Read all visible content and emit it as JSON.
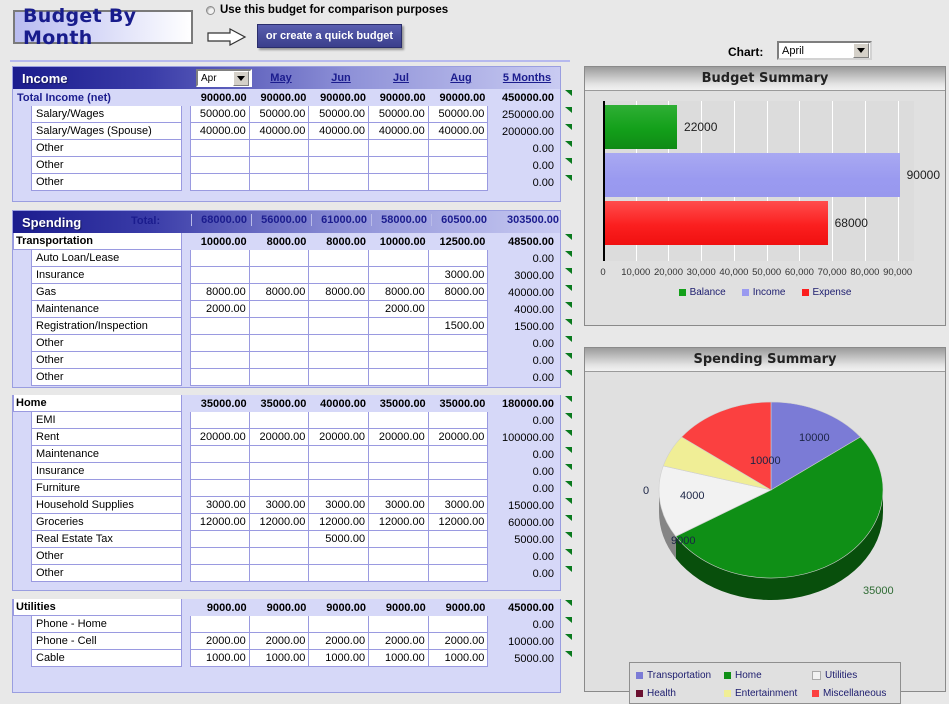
{
  "header": {
    "title": "Budget By Month",
    "comparison_label": "Use this budget for comparison purposes",
    "quick_budget_label": "or create a quick budget",
    "chart_label": "Chart:",
    "chart_selected": "April"
  },
  "columns": {
    "selected_month": "Apr",
    "months": [
      "May",
      "Jun",
      "Jul",
      "Aug"
    ],
    "total_header": "5 Months",
    "total_label": "Total:"
  },
  "income": {
    "section_title": "Income",
    "total_row": {
      "label": "Total Income (net)",
      "values": [
        "90000.00",
        "90000.00",
        "90000.00",
        "90000.00",
        "90000.00"
      ],
      "sum": "450000.00"
    },
    "rows": [
      {
        "label": "Salary/Wages",
        "values": [
          "50000.00",
          "50000.00",
          "50000.00",
          "50000.00",
          "50000.00"
        ],
        "sum": "250000.00"
      },
      {
        "label": "Salary/Wages (Spouse)",
        "values": [
          "40000.00",
          "40000.00",
          "40000.00",
          "40000.00",
          "40000.00"
        ],
        "sum": "200000.00"
      },
      {
        "label": "Other",
        "values": [
          "",
          "",
          "",
          "",
          ""
        ],
        "sum": "0.00"
      },
      {
        "label": "Other",
        "values": [
          "",
          "",
          "",
          "",
          ""
        ],
        "sum": "0.00"
      },
      {
        "label": "Other",
        "values": [
          "",
          "",
          "",
          "",
          ""
        ],
        "sum": "0.00"
      }
    ]
  },
  "spending": {
    "section_title": "Spending",
    "total_values": [
      "68000.00",
      "56000.00",
      "61000.00",
      "58000.00",
      "60500.00"
    ],
    "total_sum": "303500.00",
    "categories": [
      {
        "label": "Transportation",
        "values": [
          "10000.00",
          "8000.00",
          "8000.00",
          "10000.00",
          "12500.00"
        ],
        "sum": "48500.00",
        "rows": [
          {
            "label": "Auto Loan/Lease",
            "values": [
              "",
              "",
              "",
              "",
              ""
            ],
            "sum": "0.00"
          },
          {
            "label": "Insurance",
            "values": [
              "",
              "",
              "",
              "",
              "3000.00"
            ],
            "sum": "3000.00"
          },
          {
            "label": "Gas",
            "values": [
              "8000.00",
              "8000.00",
              "8000.00",
              "8000.00",
              "8000.00"
            ],
            "sum": "40000.00"
          },
          {
            "label": "Maintenance",
            "values": [
              "2000.00",
              "",
              "",
              "2000.00",
              ""
            ],
            "sum": "4000.00"
          },
          {
            "label": "Registration/Inspection",
            "values": [
              "",
              "",
              "",
              "",
              "1500.00"
            ],
            "sum": "1500.00"
          },
          {
            "label": "Other",
            "values": [
              "",
              "",
              "",
              "",
              ""
            ],
            "sum": "0.00"
          },
          {
            "label": "Other",
            "values": [
              "",
              "",
              "",
              "",
              ""
            ],
            "sum": "0.00"
          },
          {
            "label": "Other",
            "values": [
              "",
              "",
              "",
              "",
              ""
            ],
            "sum": "0.00"
          }
        ]
      },
      {
        "label": "Home",
        "values": [
          "35000.00",
          "35000.00",
          "40000.00",
          "35000.00",
          "35000.00"
        ],
        "sum": "180000.00",
        "rows": [
          {
            "label": "EMI",
            "values": [
              "",
              "",
              "",
              "",
              ""
            ],
            "sum": "0.00"
          },
          {
            "label": "Rent",
            "values": [
              "20000.00",
              "20000.00",
              "20000.00",
              "20000.00",
              "20000.00"
            ],
            "sum": "100000.00"
          },
          {
            "label": "Maintenance",
            "values": [
              "",
              "",
              "",
              "",
              ""
            ],
            "sum": "0.00"
          },
          {
            "label": "Insurance",
            "values": [
              "",
              "",
              "",
              "",
              ""
            ],
            "sum": "0.00"
          },
          {
            "label": "Furniture",
            "values": [
              "",
              "",
              "",
              "",
              ""
            ],
            "sum": "0.00"
          },
          {
            "label": "Household Supplies",
            "values": [
              "3000.00",
              "3000.00",
              "3000.00",
              "3000.00",
              "3000.00"
            ],
            "sum": "15000.00"
          },
          {
            "label": "Groceries",
            "values": [
              "12000.00",
              "12000.00",
              "12000.00",
              "12000.00",
              "12000.00"
            ],
            "sum": "60000.00"
          },
          {
            "label": "Real Estate Tax",
            "values": [
              "",
              "",
              "5000.00",
              "",
              ""
            ],
            "sum": "5000.00"
          },
          {
            "label": "Other",
            "values": [
              "",
              "",
              "",
              "",
              ""
            ],
            "sum": "0.00"
          },
          {
            "label": "Other",
            "values": [
              "",
              "",
              "",
              "",
              ""
            ],
            "sum": "0.00"
          }
        ]
      },
      {
        "label": "Utilities",
        "values": [
          "9000.00",
          "9000.00",
          "9000.00",
          "9000.00",
          "9000.00"
        ],
        "sum": "45000.00",
        "rows": [
          {
            "label": "Phone - Home",
            "values": [
              "",
              "",
              "",
              "",
              ""
            ],
            "sum": "0.00"
          },
          {
            "label": "Phone - Cell",
            "values": [
              "2000.00",
              "2000.00",
              "2000.00",
              "2000.00",
              "2000.00"
            ],
            "sum": "10000.00"
          },
          {
            "label": "Cable",
            "values": [
              "1000.00",
              "1000.00",
              "1000.00",
              "1000.00",
              "1000.00"
            ],
            "sum": "5000.00"
          }
        ]
      }
    ]
  },
  "budget_summary": {
    "title": "Budget Summary"
  },
  "spending_summary": {
    "title": "Spending Summary"
  },
  "chart_data": [
    {
      "type": "bar",
      "title": "Budget Summary",
      "orientation": "horizontal",
      "categories": [
        "Balance",
        "Income",
        "Expense"
      ],
      "values": [
        22000,
        90000,
        68000
      ],
      "data_labels": [
        "22000",
        "90000",
        "68000"
      ],
      "colors": [
        "#13a01a",
        "#9a9af0",
        "#fb1f1f"
      ],
      "xlabel": "",
      "ylabel": "",
      "xlim": [
        0,
        95000
      ],
      "xticks": [
        0,
        10000,
        20000,
        30000,
        40000,
        50000,
        60000,
        70000,
        80000,
        90000
      ],
      "xtick_labels": [
        "0",
        "10,000",
        "20,000",
        "30,000",
        "40,000",
        "50,000",
        "60,000",
        "70,000",
        "80,000",
        "90,000"
      ],
      "grid": true,
      "legend": [
        "Balance",
        "Income",
        "Expense"
      ],
      "legend_position": "bottom"
    },
    {
      "type": "pie",
      "title": "Spending Summary",
      "labels": [
        "Transportation",
        "Home",
        "Utilities",
        "Health",
        "Entertainment",
        "Miscellaneous"
      ],
      "values": [
        10000,
        35000,
        9000,
        0,
        4000,
        10000
      ],
      "data_labels": [
        "10000",
        "35000",
        "9000",
        "0",
        "4000",
        "10000"
      ],
      "colors": [
        "#7b7bd6",
        "#0f8f16",
        "#f2f2f2",
        "#6b1030",
        "#f0ee96",
        "#fb4040"
      ],
      "legend": [
        "Transportation",
        "Home",
        "Utilities",
        "Health",
        "Entertainment",
        "Miscellaneous"
      ],
      "legend_position": "bottom",
      "style": "3d"
    }
  ]
}
